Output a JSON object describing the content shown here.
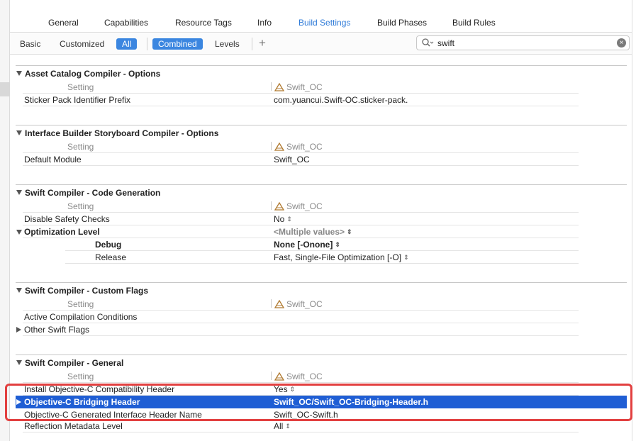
{
  "tabs": [
    "General",
    "Capabilities",
    "Resource Tags",
    "Info",
    "Build Settings",
    "Build Phases",
    "Build Rules"
  ],
  "active_tab": "Build Settings",
  "filters": {
    "basic": "Basic",
    "customized": "Customized",
    "all": "All",
    "combined": "Combined",
    "levels": "Levels",
    "add": "+"
  },
  "search": {
    "value": "swift"
  },
  "colors": {
    "accent": "#3b86e0",
    "selection": "#1f5ed4",
    "highlight": "#e24040"
  },
  "setting_header": {
    "label": "Setting",
    "target": "Swift_OC"
  },
  "sections": {
    "asset": {
      "title": "Asset Catalog Compiler - Options",
      "rows": [
        {
          "label": "Sticker Pack Identifier Prefix",
          "value": "com.yuancui.Swift-OC.sticker-pack."
        }
      ]
    },
    "ib": {
      "title": "Interface Builder Storyboard Compiler - Options",
      "rows": [
        {
          "label": "Default Module",
          "value": "Swift_OC"
        }
      ]
    },
    "codegen": {
      "title": "Swift Compiler - Code Generation",
      "rows": [
        {
          "label": "Disable Safety Checks",
          "value": "No"
        },
        {
          "label": "Optimization Level",
          "value": "<Multiple values>"
        },
        {
          "label": "Debug",
          "value": "None [-Onone]"
        },
        {
          "label": "Release",
          "value": "Fast, Single-File Optimization [-O]"
        }
      ]
    },
    "flags": {
      "title": "Swift Compiler - Custom Flags",
      "rows": [
        {
          "label": "Active Compilation Conditions",
          "value": ""
        },
        {
          "label": "Other Swift Flags",
          "value": ""
        }
      ]
    },
    "general": {
      "title": "Swift Compiler - General",
      "rows": [
        {
          "label": "Install Objective-C Compatibility Header",
          "value": "Yes"
        },
        {
          "label": "Objective-C Bridging Header",
          "value": "Swift_OC/Swift_OC-Bridging-Header.h"
        },
        {
          "label": "Objective-C Generated Interface Header Name",
          "value": "Swift_OC-Swift.h"
        },
        {
          "label": "Reflection Metadata Level",
          "value": "All"
        }
      ]
    }
  }
}
